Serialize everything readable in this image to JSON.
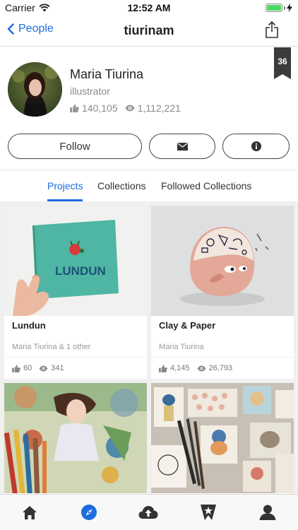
{
  "status_bar": {
    "carrier": "Carrier",
    "time": "12:52 AM",
    "battery_level": 1.0,
    "battery_color": "#4cd964"
  },
  "nav": {
    "back_label": "People",
    "title": "tiurinam",
    "back_icon": "chevron-left-icon",
    "share_icon": "share-icon"
  },
  "profile": {
    "name": "Maria Tiurina",
    "role": "illustrator",
    "appreciations": "140,105",
    "views": "1,112,221",
    "badge_count": "36",
    "follow_label": "Follow",
    "message_icon": "envelope-icon",
    "info_icon": "info-icon"
  },
  "tabs": {
    "projects": "Projects",
    "collections": "Collections",
    "followed": "Followed Collections",
    "active": "projects"
  },
  "projects": [
    {
      "title": "Lundun",
      "owner": "Maria Tiurina & 1 other",
      "likes": "60",
      "views": "341"
    },
    {
      "title": "Clay & Paper",
      "owner": "Maria Tiurina",
      "likes": "4,145",
      "views": "26,793"
    },
    {
      "title": "",
      "owner": "",
      "likes": "",
      "views": ""
    },
    {
      "title": "",
      "owner": "",
      "likes": "",
      "views": ""
    }
  ],
  "book_cover_text": "LUNDUN",
  "tabbar": [
    "home-icon",
    "discover-icon",
    "upload-icon",
    "featured-icon",
    "profile-icon"
  ],
  "colors": {
    "accent": "#1d6ce0",
    "badge": "#3b3b3b"
  }
}
